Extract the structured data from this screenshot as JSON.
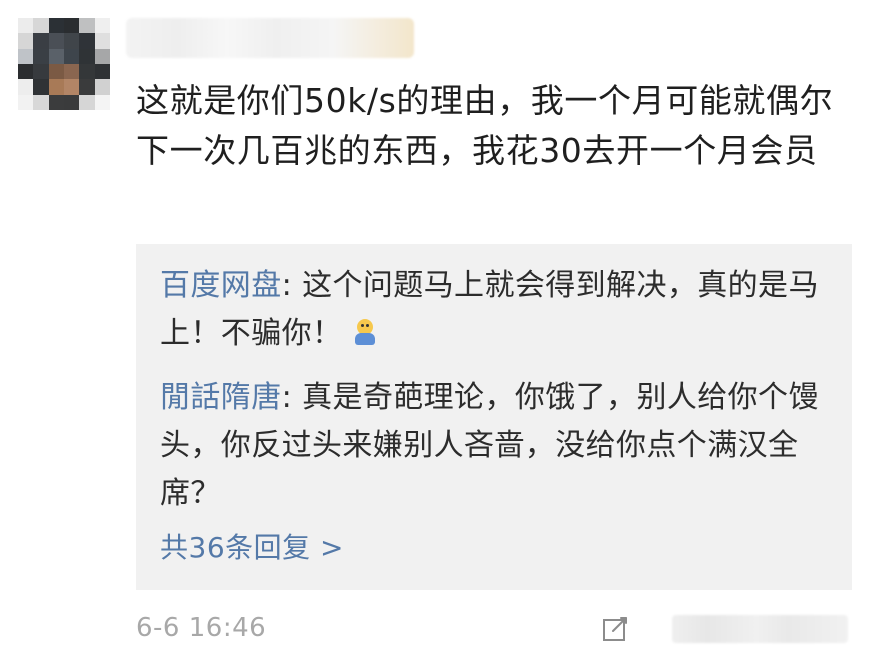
{
  "post": {
    "comment_text": "这就是你们50k/s的理由，我一个月可能就偶尔下一次几百兆的东西，我花30去开一个月会员"
  },
  "replies": [
    {
      "author": "百度网盘",
      "separator": ": ",
      "text": "这个问题马上就会得到解决，真的是马上！不骗你！",
      "emoji": "smiley-emoji"
    },
    {
      "author": "閒話隋唐",
      "separator": ": ",
      "text": "真是奇葩理论，你饿了，别人给你个馒头，你反过头来嫌别人吝啬，没给你点个满汉全席？"
    }
  ],
  "more_replies_label": "共36条回复 >",
  "timestamp": "6-6 16:46",
  "icons": {
    "avatar": "avatar-icon",
    "edit": "edit-icon"
  },
  "colors": {
    "accent": "#5479a8",
    "reply_bg": "#f1f1f1",
    "muted": "#a8a8a8"
  }
}
